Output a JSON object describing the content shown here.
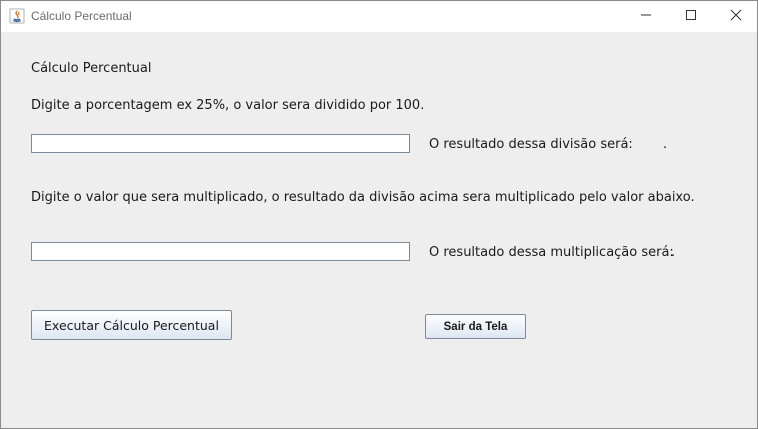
{
  "window": {
    "title": "Cálculo Percentual",
    "app_icon": "java-icon",
    "controls": {
      "minimize": "minimize-icon",
      "maximize": "maximize-icon",
      "close": "close-icon"
    }
  },
  "form": {
    "heading": "Cálculo Percentual",
    "instruction_percent": "Digite a porcentagem ex 25%, o valor sera dividido por 100.",
    "percent_input": {
      "value": ""
    },
    "division_result_label": "O resultado dessa divisão será:",
    "division_result_value": ".",
    "instruction_value": "Digite o valor que sera multiplicado, o resultado da divisão acima sera multiplicado pelo valor abaixo.",
    "value_input": {
      "value": ""
    },
    "multiplication_result_label": "O resultado dessa multiplicação será:",
    "multiplication_result_value": "."
  },
  "buttons": {
    "execute_label": "Executar Cálculo Percentual",
    "exit_label": "Sair da Tela"
  }
}
